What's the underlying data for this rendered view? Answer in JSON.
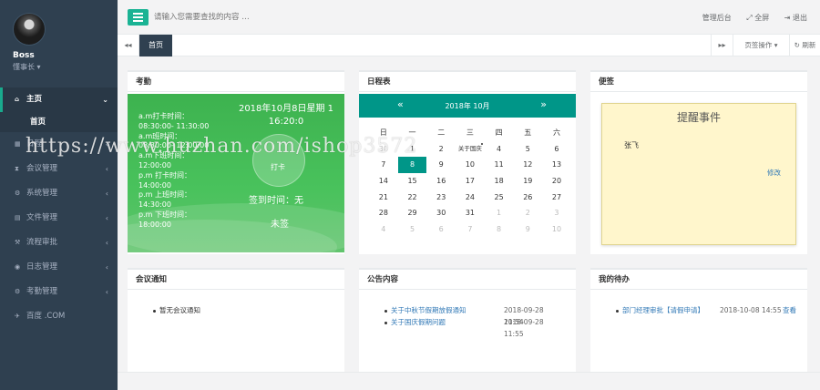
{
  "profile": {
    "name": "Boss",
    "role": "懂事长 ▾"
  },
  "sidebar": {
    "items": [
      {
        "icon": "home-icon",
        "glyph": "⌂",
        "label": "主页",
        "arrow": "⌄"
      },
      {
        "icon": "calendar-icon",
        "glyph": "▦",
        "label": "日程",
        "arrow": "‹"
      },
      {
        "icon": "hourglass-icon",
        "glyph": "⧗",
        "label": "会议管理",
        "arrow": "‹"
      },
      {
        "icon": "gear-icon",
        "glyph": "⚙",
        "label": "系统管理",
        "arrow": "‹"
      },
      {
        "icon": "file-icon",
        "glyph": "▤",
        "label": "文件管理",
        "arrow": "‹"
      },
      {
        "icon": "gavel-icon",
        "glyph": "⚒",
        "label": "流程审批",
        "arrow": "‹"
      },
      {
        "icon": "eye-icon",
        "glyph": "◉",
        "label": "日志管理",
        "arrow": "‹"
      },
      {
        "icon": "cogs-icon",
        "glyph": "⚙",
        "label": "考勤管理",
        "arrow": "‹"
      },
      {
        "icon": "plane-icon",
        "glyph": "✈",
        "label": "百度 .COM",
        "arrow": ""
      }
    ],
    "sub_home": "首页"
  },
  "topbar": {
    "search_placeholder": "请输入您需要查找的内容 …",
    "admin": "管理后台",
    "fullscreen": "⤢ 全屏",
    "logout": "⇥ 退出"
  },
  "tabs": {
    "prev": "◂◂",
    "home": "首页",
    "next": "▸▸",
    "ops": "页签操作 ▾",
    "refresh": "↻ 刷新"
  },
  "attendance": {
    "title": "考勤",
    "lines": [
      "a.m打卡时间：",
      "08:30:00- 11:30:00",
      "a.m班时间：",
      "08:30:00- 12:00:00",
      "a.m下班时间：",
      "12:00:00",
      "p.m 打卡时间：",
      "14:00:00",
      "p.m 上班时间：",
      "14:30:00",
      "p.m 下班时间：",
      "18:00:00"
    ],
    "date": "2018年10月8日星期 1",
    "time": "16:20:0",
    "punch": "打卡",
    "sign": "签到时间：无",
    "off": "未签"
  },
  "calendar": {
    "title": "日程表",
    "prev": "«",
    "next": "»",
    "month": "2018年  10月",
    "weekdays": [
      "日",
      "一",
      "二",
      "三",
      "四",
      "五",
      "六"
    ],
    "rows": [
      [
        "30",
        "1",
        "2",
        "关于国庆",
        "4",
        "5",
        "6"
      ],
      [
        "7",
        "8",
        "9",
        "10",
        "11",
        "12",
        "13"
      ],
      [
        "14",
        "15",
        "16",
        "17",
        "18",
        "19",
        "20"
      ],
      [
        "21",
        "22",
        "23",
        "24",
        "25",
        "26",
        "27"
      ],
      [
        "28",
        "29",
        "30",
        "31",
        "1",
        "2",
        "3"
      ],
      [
        "4",
        "5",
        "6",
        "7",
        "8",
        "9",
        "10"
      ]
    ],
    "today": "8"
  },
  "notes": {
    "title": "便签",
    "note_title": "提醒事件",
    "note_text": "张飞",
    "edit": "修改"
  },
  "meeting": {
    "title": "会议通知",
    "items": [
      "暂无会议通知"
    ]
  },
  "announce": {
    "title": "公告内容",
    "items": [
      {
        "text": "关于中秋节假期放假通知",
        "date": "2018-09-28 11:54"
      },
      {
        "text": "关于国庆假期问题",
        "date": "2018-09-28 11:55"
      }
    ]
  },
  "todo": {
    "title": "我的待办",
    "items": [
      {
        "text": "部门经理审批【请假申请】",
        "date": "2018-10-08 14:55",
        "action": "查看"
      }
    ]
  },
  "watermark": "https://www.huzhan.com/ishop3572"
}
